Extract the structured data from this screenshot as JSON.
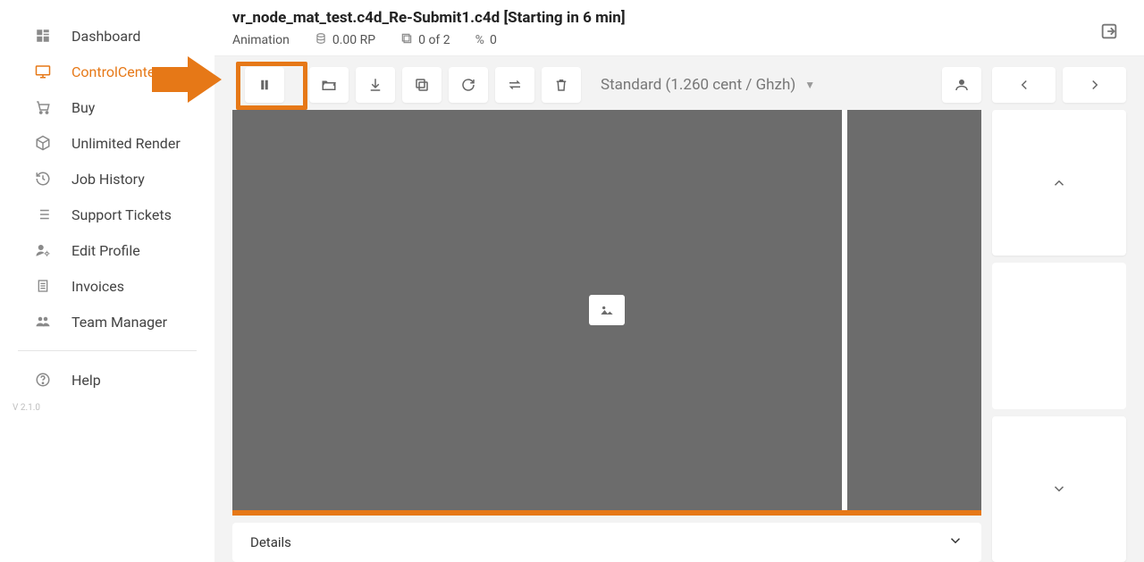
{
  "sidebar": {
    "items": [
      {
        "label": "Dashboard"
      },
      {
        "label": "ControlCenter"
      },
      {
        "label": "Buy"
      },
      {
        "label": "Unlimited Render"
      },
      {
        "label": "Job History"
      },
      {
        "label": "Support Tickets"
      },
      {
        "label": "Edit Profile"
      },
      {
        "label": "Invoices"
      },
      {
        "label": "Team Manager"
      }
    ],
    "help_label": "Help",
    "active_index": 1
  },
  "version": "V 2.1.0",
  "header": {
    "title": "vr_node_mat_test.c4d_Re-Submit1.c4d [Starting in 6 min]",
    "type_label": "Animation",
    "render_points": "0.00 RP",
    "frames": "0 of 2",
    "percent": "0"
  },
  "toolbar": {
    "pricing_label": "Standard (1.260 cent / Ghzh)"
  },
  "details": {
    "label": "Details"
  },
  "colors": {
    "accent": "#e67817"
  }
}
